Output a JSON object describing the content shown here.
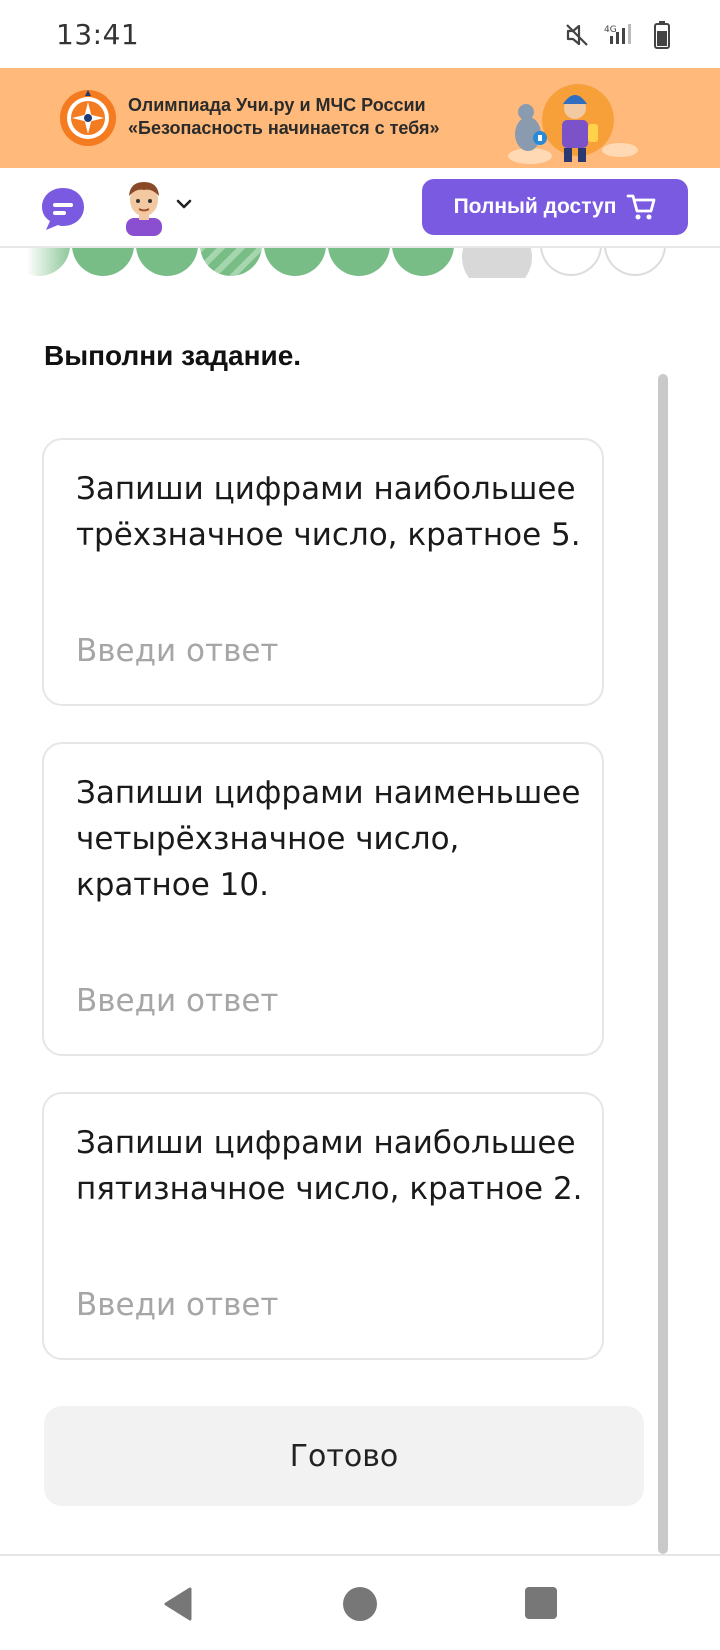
{
  "status_bar": {
    "time": "13:41",
    "icons": [
      "mute-icon",
      "signal-4g-icon",
      "battery-icon"
    ]
  },
  "banner": {
    "line1": "Олимпиада Учи.ру и МЧС России",
    "line2": "«Безопасность начинается с тебя»",
    "background_color": "#ffb97a",
    "logo_icon": "emergency-compass-logo-icon"
  },
  "header": {
    "full_access_label": "Полный доступ",
    "accent_color": "#7a5ae0",
    "icons": [
      "chat-icon",
      "avatar",
      "chevron-down-icon",
      "cart-icon"
    ]
  },
  "progress": {
    "dots": [
      "partial-green",
      "green",
      "green-striped",
      "green",
      "green",
      "green",
      "current-grey",
      "empty",
      "empty"
    ]
  },
  "task": {
    "instruction": "Выполни задание.",
    "questions": [
      {
        "text": "Запиши цифрами наибольшее трёхзначное число, кратное 5.",
        "placeholder": "Введи ответ",
        "value": ""
      },
      {
        "text": "Запиши цифрами наименьшее четырёхзначное число, кратное 10.",
        "placeholder": "Введи ответ",
        "value": ""
      },
      {
        "text": "Запиши цифрами наибольшее пятизначное число, кратное 2.",
        "placeholder": "Введи ответ",
        "value": ""
      }
    ],
    "done_label": "Готово"
  },
  "nav": {
    "icons": [
      "back-icon",
      "home-icon",
      "recent-apps-icon"
    ]
  }
}
